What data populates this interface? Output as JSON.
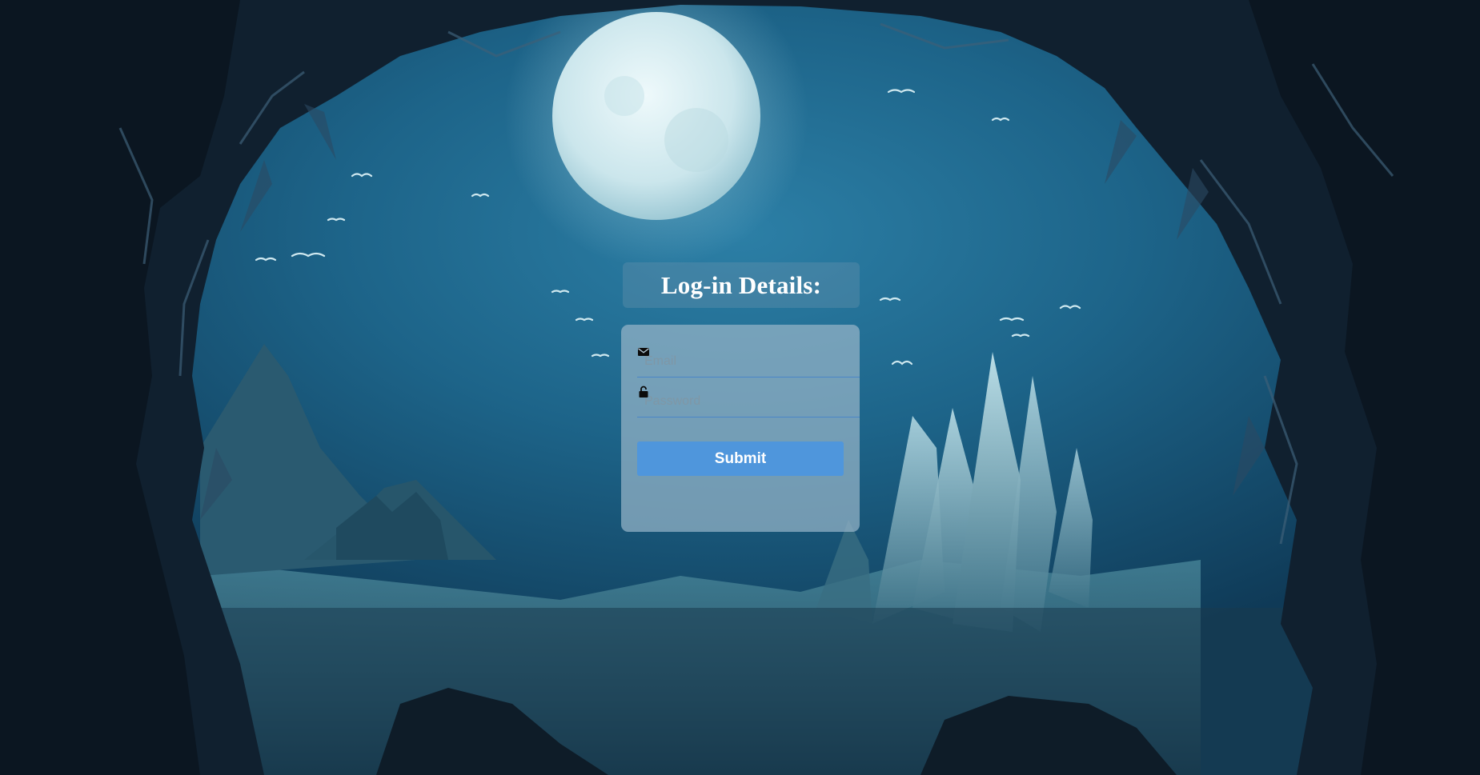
{
  "login": {
    "heading": "Log-in Details:",
    "email": {
      "icon": "envelope-icon",
      "placeholder": "Email",
      "value": ""
    },
    "password": {
      "icon": "unlocked-padlock-icon",
      "placeholder": "Password",
      "value": ""
    },
    "submit_label": "Submit"
  },
  "colors": {
    "button": "#4f96dc",
    "input_underline": "#4a86c8",
    "heading_text": "#ffffff"
  }
}
